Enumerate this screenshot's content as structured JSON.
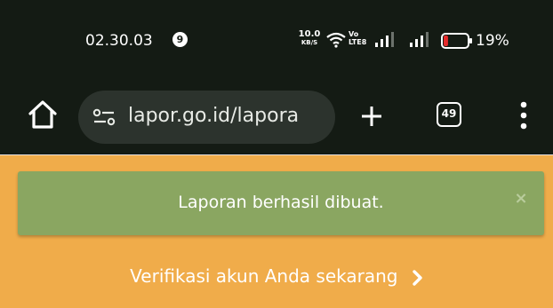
{
  "status_bar": {
    "time": "02.30.03",
    "notification_count": "9",
    "net_speed_value": "10.0",
    "net_speed_unit": "KB/S",
    "volte_top": "Vo",
    "volte_bottom": "LTE8",
    "battery_percent": "19%",
    "battery_level": 0.19,
    "battery_color": "#e52b2b"
  },
  "browser": {
    "url": "lapor.go.id/lapora",
    "tabs_count": "49"
  },
  "page": {
    "alert_message": "Laporan berhasil dibuat.",
    "alert_close": "×",
    "verify_link": "Verifikasi akun Anda sekarang",
    "background_color": "#f0ac4a",
    "alert_color": "#8aa661"
  }
}
